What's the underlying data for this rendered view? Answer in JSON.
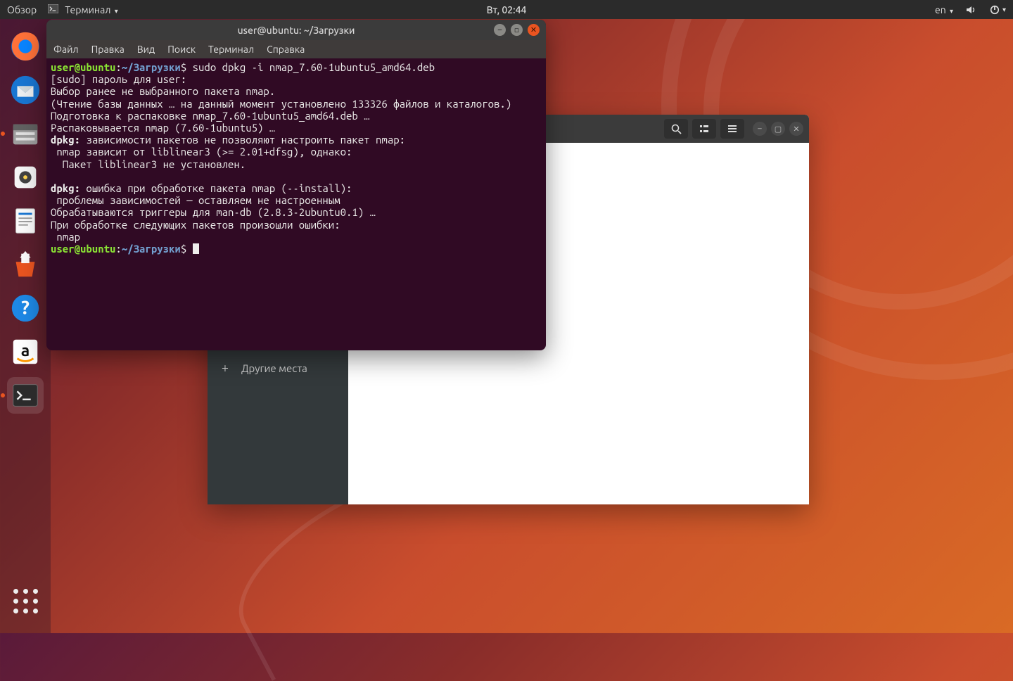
{
  "topbar": {
    "activities": "Обзор",
    "app_menu": "Терминал",
    "clock": "Вт, 02:44",
    "lang": "en"
  },
  "nautilus": {
    "sidebar_other": "Другие места"
  },
  "terminal": {
    "title": "user@ubuntu: ~/Загрузки",
    "menu": {
      "file": "Файл",
      "edit": "Правка",
      "view": "Вид",
      "search": "Поиск",
      "terminal": "Терминал",
      "help": "Справка"
    },
    "prompt": {
      "userhost": "user@ubuntu",
      "sep": ":",
      "path": "~/Загрузки",
      "dollar": "$"
    },
    "command": " sudo dpkg -i nmap_7.60-1ubuntu5_amd64.deb",
    "lines": {
      "l1": "[sudo] пароль для user:",
      "l2": "Выбор ранее не выбранного пакета nmap.",
      "l3": "(Чтение базы данных … на данный момент установлено 133326 файлов и каталогов.)",
      "l4": "Подготовка к распаковке nmap_7.60-1ubuntu5_amd64.deb …",
      "l5": "Распаковывается nmap (7.60-1ubuntu5) …",
      "l6a": "dpkg:",
      "l6b": " зависимости пакетов не позволяют настроить пакет nmap:",
      "l7": " nmap зависит от liblinear3 (>= 2.01+dfsg), однако:",
      "l8": "  Пакет liblinear3 не установлен.",
      "l9": "",
      "l10a": "dpkg:",
      "l10b": " ошибка при обработке пакета nmap (--install):",
      "l11": " проблемы зависимостей — оставляем не настроенным",
      "l12": "Обрабатываются триггеры для man-db (2.8.3-2ubuntu0.1) …",
      "l13": "При обработке следующих пакетов произошли ошибки:",
      "l14": " nmap"
    }
  }
}
